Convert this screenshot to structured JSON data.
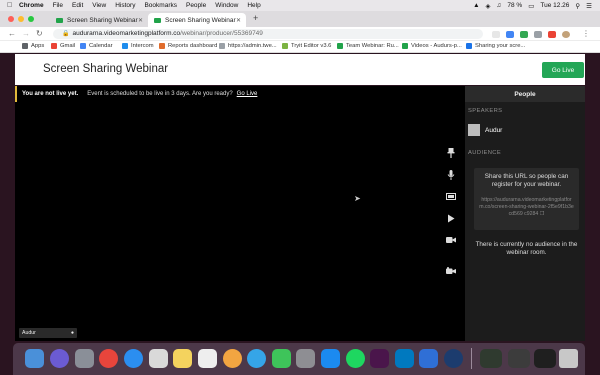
{
  "menubar": {
    "app": "Chrome",
    "items": [
      "File",
      "Edit",
      "View",
      "History",
      "Bookmarks",
      "People",
      "Window",
      "Help"
    ],
    "battery": "78 %",
    "clock": "Tue 12.26"
  },
  "tabs": [
    {
      "title": "Screen Sharing Webinar"
    },
    {
      "title": "Screen Sharing Webinar"
    }
  ],
  "address": {
    "host": "audurarna.videomarketingplatform.co",
    "path": "/webinar/producer/55369749"
  },
  "bookmarks": [
    "Apps",
    "Gmail",
    "Calendar",
    "Intercom",
    "Reports dashboard",
    "https://admin.twe...",
    "Tryit Editor v3.6",
    "Team Webinar: Ru...",
    "Videos - Audurs-p...",
    "Sharing your scre..."
  ],
  "page": {
    "title": "Screen Sharing Webinar",
    "go_live_button": "Go Live",
    "banner_status": "You are not live yet.",
    "banner_message": "Event is scheduled to be live in 3 days. Are you ready?",
    "banner_link": "Go Live"
  },
  "video": {
    "participant_name": "Audur"
  },
  "panel": {
    "title": "People",
    "speakers_heading": "SPEAKERS",
    "speaker_name": "Audur",
    "audience_heading": "AUDIENCE",
    "share_text": "Share this URL so people can register for your webinar.",
    "share_url": "https://audurarna.videomarketingplatform.co/screen-sharing-webinar-2f5e9f1b3ecd569 c9284",
    "no_audience": "There is currently no audience in the webinar room."
  },
  "colors": {
    "accent_green": "#23a656",
    "banner_accent": "#e2b93b",
    "panel_bg": "#1c1c1c"
  }
}
